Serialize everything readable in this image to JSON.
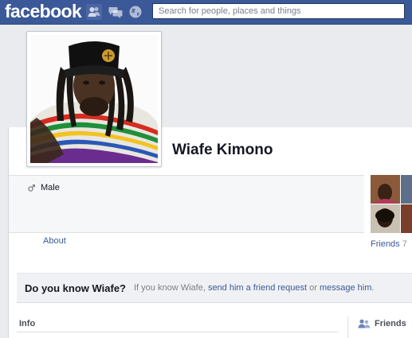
{
  "header": {
    "logo": "facebook",
    "search_placeholder": "Search for people, places and things"
  },
  "profile": {
    "name": "Wiafe Kimono",
    "gender": "Male",
    "about_link": "About",
    "friends_label": "Friends",
    "friends_count": "7"
  },
  "know_box": {
    "title": "Do you know Wiafe?",
    "text_before": "If you know Wiafe,",
    "request_link": "send him a friend request",
    "text_or": "or",
    "message_link": "message him",
    "text_end": "."
  },
  "sections": {
    "info_title": "Info",
    "friends_title": "Friends"
  },
  "icons": {
    "friends_jewel": "friends-icon",
    "messages_jewel": "messages-icon",
    "notifications_jewel": "globe-icon",
    "gender": "male-icon",
    "friends_section": "friends-icon"
  },
  "colors": {
    "brand_blue": "#3b5998",
    "page_bg": "#e9ebee",
    "link": "#3b5998"
  }
}
